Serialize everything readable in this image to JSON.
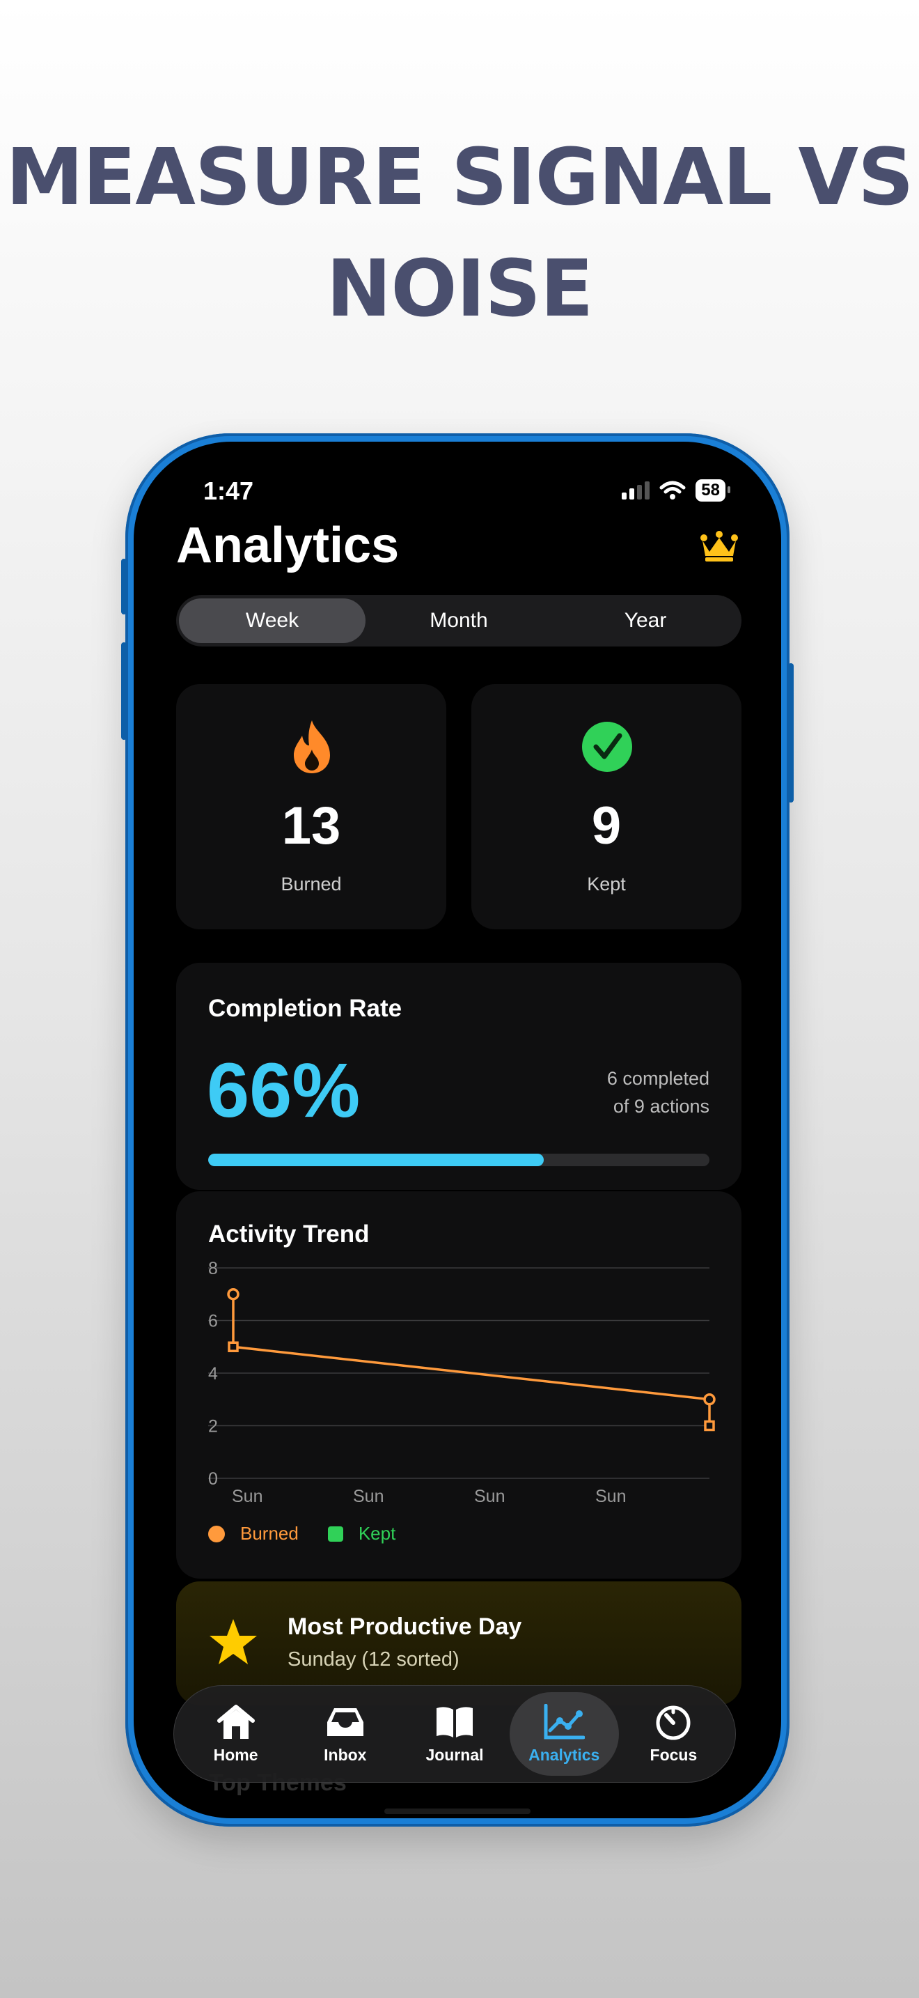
{
  "headline": {
    "line1": "MEASURE SIGNAL VS",
    "line2": "NOISE"
  },
  "status_bar": {
    "time": "1:47",
    "battery": "58"
  },
  "page": {
    "title": "Analytics",
    "premium_icon": "crown-icon"
  },
  "segments": {
    "items": [
      "Week",
      "Month",
      "Year"
    ],
    "selected": "Week"
  },
  "stats": {
    "burned": {
      "value": "13",
      "label": "Burned",
      "icon": "flame-icon",
      "color": "#ff8a2a"
    },
    "kept": {
      "value": "9",
      "label": "Kept",
      "icon": "checkmark-circle-icon",
      "color": "#30d158"
    }
  },
  "completion": {
    "title": "Completion Rate",
    "percent_text": "66%",
    "detail_line1": "6 completed",
    "detail_line2": "of 9 actions",
    "progress_fraction": 0.67,
    "color": "#3ecbf5"
  },
  "trend": {
    "title": "Activity Trend",
    "legend_burned": "Burned",
    "legend_kept": "Kept"
  },
  "chart_data": {
    "type": "line",
    "title": "Activity Trend",
    "x": [
      0,
      1
    ],
    "x_tick_labels": [
      "Sun",
      "Sun",
      "Sun",
      "Sun"
    ],
    "y_ticks": [
      "0",
      "2",
      "4",
      "6",
      "8"
    ],
    "ylim": [
      0,
      8
    ],
    "grid": true,
    "legend_placement": "bottom-left",
    "series": [
      {
        "name": "Burned",
        "values": [
          7,
          3
        ],
        "color": "#ff9a3c",
        "marker": "circle"
      },
      {
        "name": "Kept",
        "values": [
          5,
          2
        ],
        "color": "#ff9a3c",
        "marker": "square"
      }
    ]
  },
  "productive": {
    "title": "Most Productive Day",
    "subtitle": "Sunday (12 sorted)",
    "icon": "star-icon"
  },
  "top_themes": "Top Themes",
  "tabs": {
    "items": [
      {
        "label": "Home",
        "icon": "house-icon"
      },
      {
        "label": "Inbox",
        "icon": "tray-icon"
      },
      {
        "label": "Journal",
        "icon": "book-icon"
      },
      {
        "label": "Analytics",
        "icon": "chart-line-icon"
      },
      {
        "label": "Focus",
        "icon": "timer-icon"
      }
    ],
    "selected": "Analytics"
  }
}
